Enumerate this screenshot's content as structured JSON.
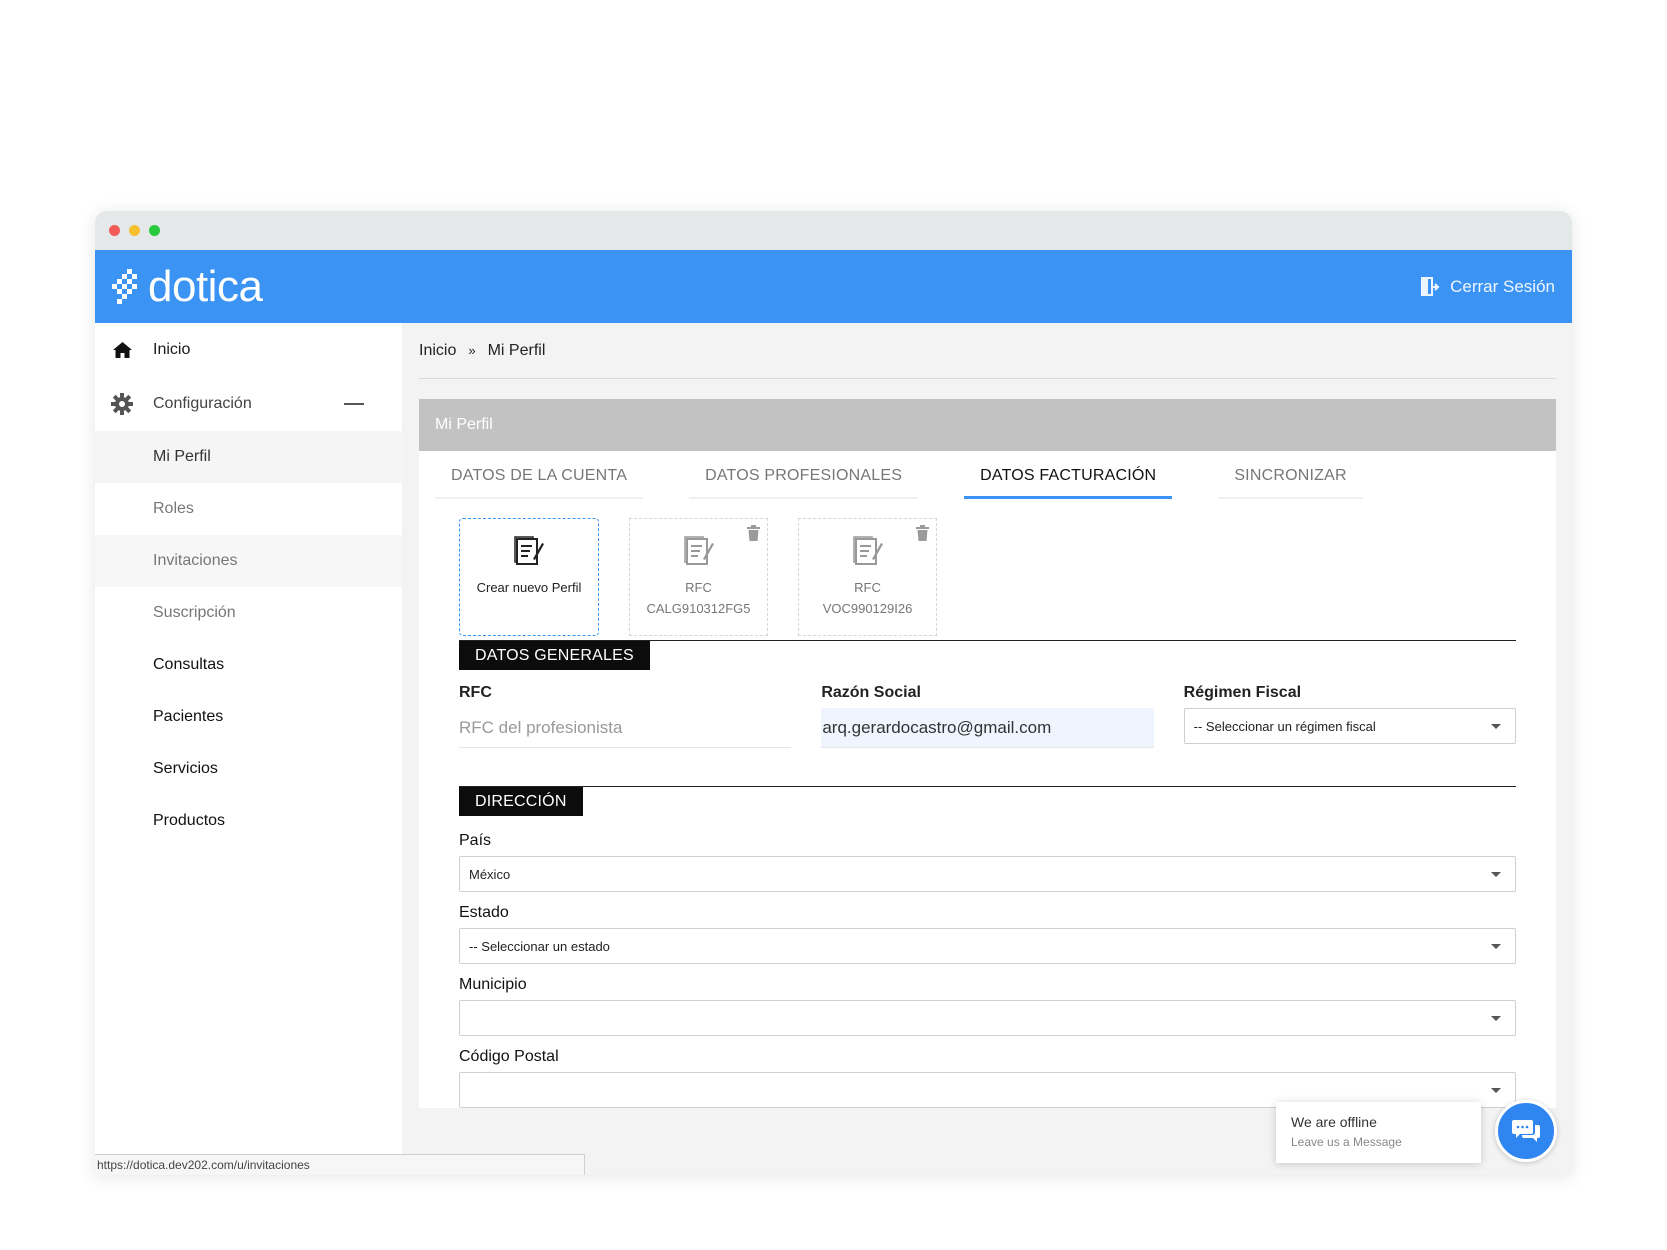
{
  "app": {
    "logo_text": "dotica",
    "brand_color": "#3b94f4",
    "logout_label": "Cerrar Sesión"
  },
  "sidebar": {
    "home_label": "Inicio",
    "config_label": "Configuración",
    "sub_items": [
      "Mi Perfil",
      "Roles",
      "Invitaciones",
      "Suscripción"
    ],
    "main_items": [
      "Consultas",
      "Pacientes",
      "Servicios",
      "Productos"
    ]
  },
  "breadcrumb": {
    "home": "Inicio",
    "separator": "»",
    "current": "Mi Perfil"
  },
  "panel": {
    "title": "Mi Perfil",
    "tabs": [
      "DATOS DE LA CUENTA",
      "DATOS PROFESIONALES",
      "DATOS FACTURACIÓN",
      "SINCRONIZAR"
    ],
    "active_tab": "DATOS FACTURACIÓN"
  },
  "cards": {
    "new_label": "Crear nuevo Perfil",
    "items": [
      {
        "label": "RFC",
        "value": "CALG910312FG5"
      },
      {
        "label": "RFC",
        "value": "VOC990129I26"
      }
    ]
  },
  "datos_generales": {
    "title": "DATOS GENERALES",
    "rfc_label": "RFC",
    "rfc_placeholder": "RFC del profesionista",
    "razon_label": "Razón Social",
    "razon_value": "arq.gerardocastro@gmail.com",
    "regimen_label": "Régimen Fiscal",
    "regimen_value": "-- Seleccionar un régimen fiscal"
  },
  "direccion": {
    "title": "DIRECCIÓN",
    "pais_label": "País",
    "pais_value": "México",
    "estado_label": "Estado",
    "estado_value": "-- Seleccionar un estado",
    "municipio_label": "Municipio",
    "municipio_value": "",
    "cp_label": "Código Postal",
    "cp_value": ""
  },
  "status_url": "https://dotica.dev202.com/u/invitaciones",
  "chat": {
    "title": "We are offline",
    "subtitle": "Leave us a Message"
  }
}
